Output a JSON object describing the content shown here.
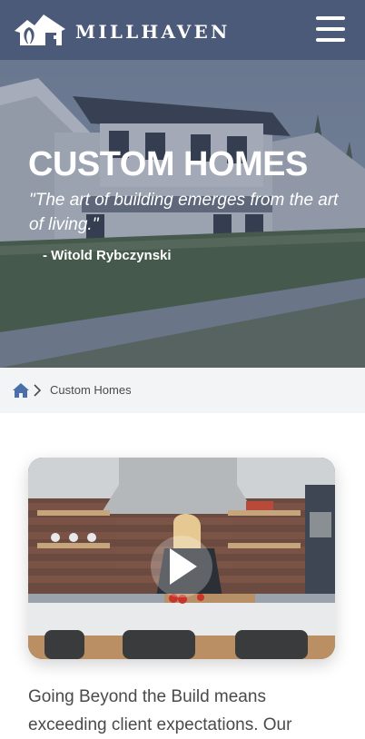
{
  "header": {
    "brand": "MILLHAVEN",
    "logo_icon": "house-logo-icon",
    "menu_icon": "hamburger-menu-icon",
    "background": "#4b5a78"
  },
  "hero": {
    "title": "CUSTOM HOMES",
    "quote": "\"The art of building emerges from the art of living.\"",
    "author": "- Witold Rybczynski"
  },
  "breadcrumb": {
    "home_icon": "home-icon",
    "separator_icon": "chevron-right-icon",
    "current": "Custom Homes"
  },
  "video": {
    "play_icon": "play-icon"
  },
  "content": {
    "intro": "Going Beyond the Build means exceeding client expectations. Our"
  }
}
